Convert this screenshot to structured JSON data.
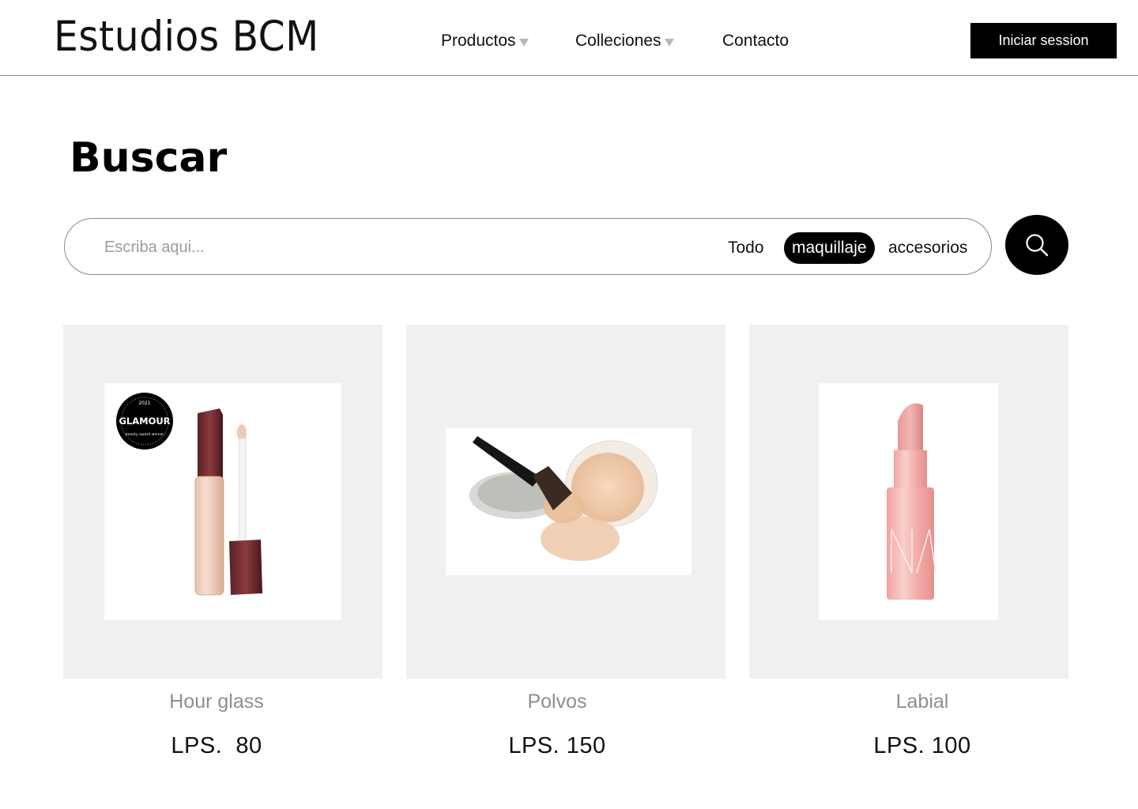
{
  "header": {
    "brand": "Estudios BCM",
    "nav": {
      "productos": "Productos",
      "colleciones": "Colleciones",
      "contacto": "Contacto"
    },
    "login_label": "Iniciar session"
  },
  "page_title": "Buscar",
  "search": {
    "placeholder": "Escriba aqui...",
    "filters": {
      "todo": "Todo",
      "maquillaje": "maquillaje",
      "accesorios": "accesorios"
    },
    "active_filter": "maquillaje"
  },
  "products": [
    {
      "name": "Hour glass",
      "price": "LPS.  80",
      "badge_top": "2021",
      "badge_text": "GLAMOUR",
      "badge_bottom": "beauty award winner"
    },
    {
      "name": "Polvos",
      "price": "LPS. 150"
    },
    {
      "name": "Labial",
      "price": "LPS. 100"
    }
  ],
  "colors": {
    "accent": "#000000",
    "card_bg": "#f0f0f0",
    "muted_text": "#8e8e8e"
  },
  "icons": {
    "search": "search-icon",
    "dropdown": "caret-down-icon"
  }
}
